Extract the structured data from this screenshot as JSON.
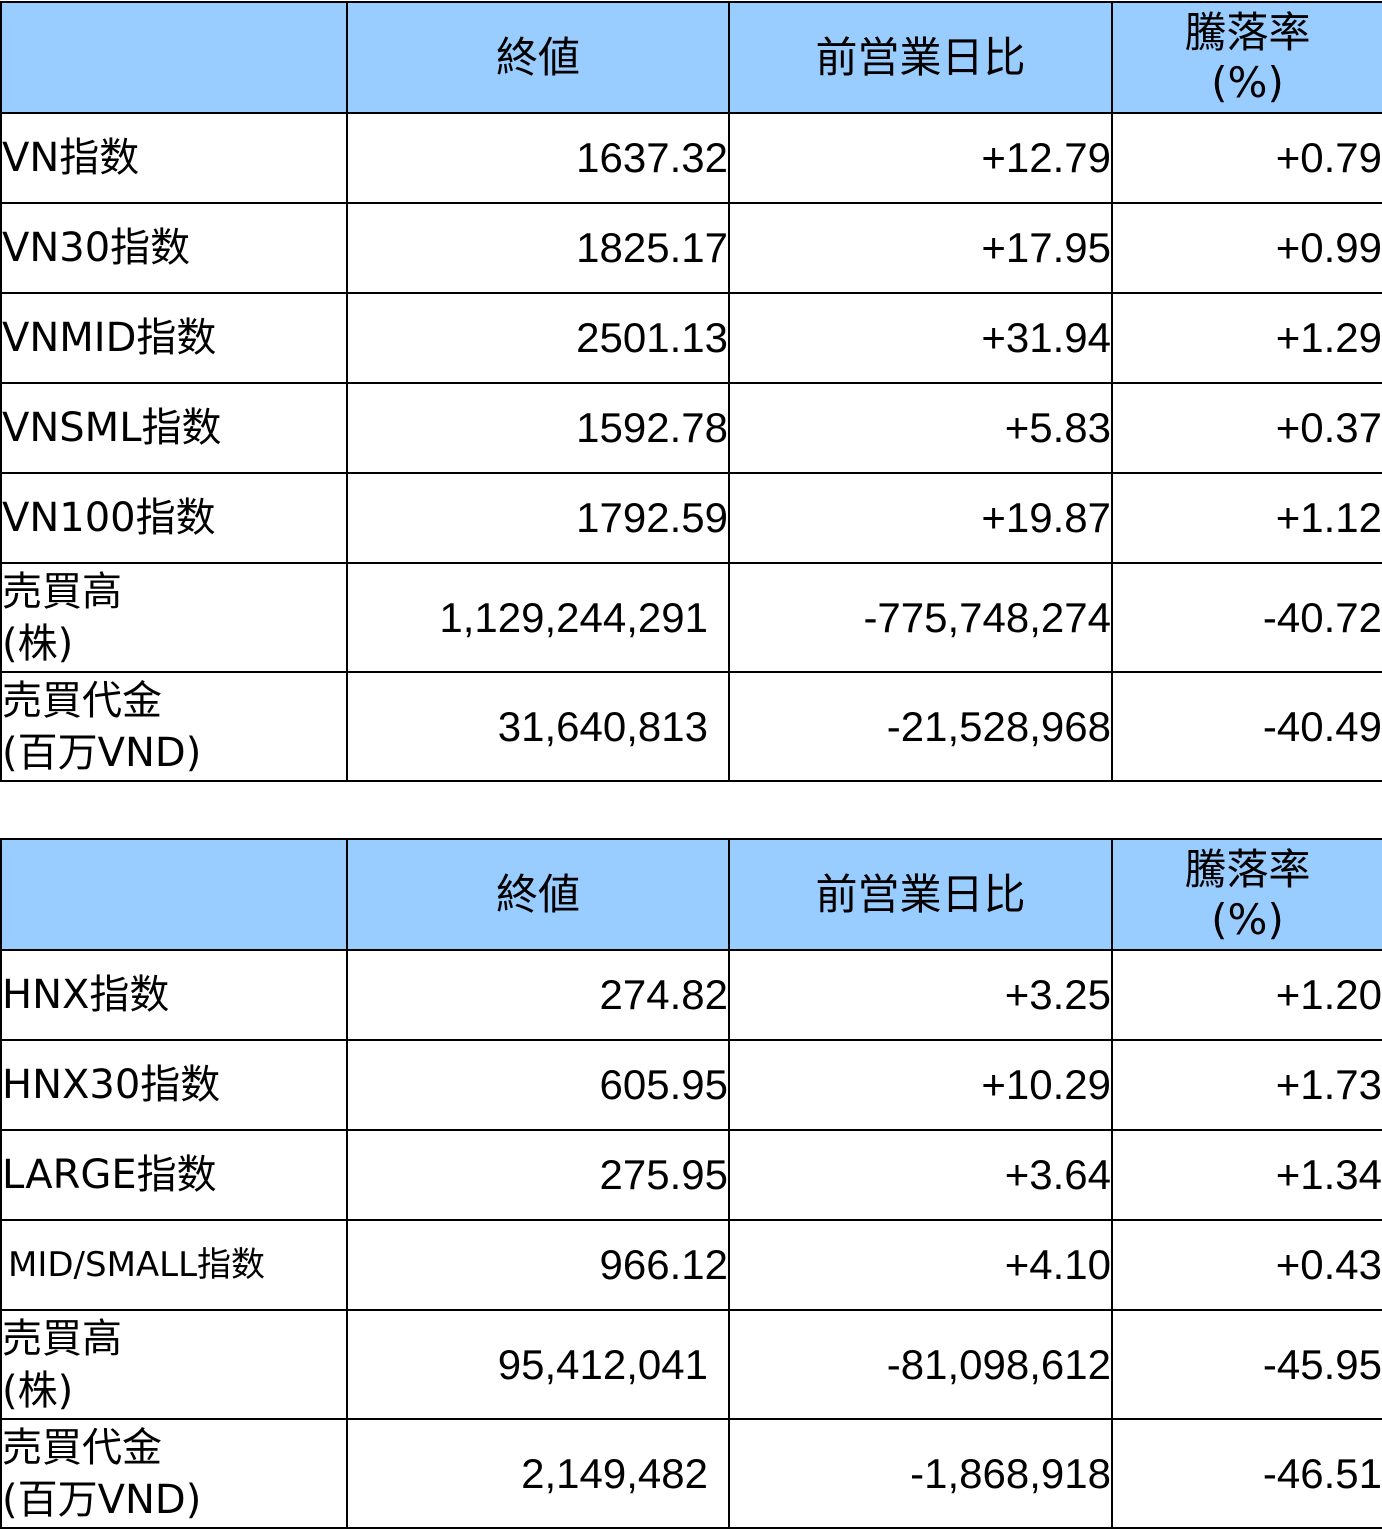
{
  "header": {
    "blank": "",
    "close": "終値",
    "change": "前営業日比",
    "rate_line1": "騰落率",
    "rate_line2": "(%)"
  },
  "vn_table": {
    "rows": [
      {
        "label": "VN指数",
        "close": "1637.32",
        "change": "+12.79",
        "rate": "+0.79"
      },
      {
        "label": "VN30指数",
        "close": "1825.17",
        "change": "+17.95",
        "rate": "+0.99"
      },
      {
        "label": "VNMID指数",
        "close": "2501.13",
        "change": "+31.94",
        "rate": "+1.29"
      },
      {
        "label": "VNSML指数",
        "close": "1592.78",
        "change": "+5.83",
        "rate": "+0.37"
      },
      {
        "label": "VN100指数",
        "close": "1792.59",
        "change": "+19.87",
        "rate": "+1.12"
      },
      {
        "label_line1": "売買高",
        "label_line2": "(株)",
        "close": "1,129,244,291",
        "change": "-775,748,274",
        "rate": "-40.72"
      },
      {
        "label_line1": "売買代金",
        "label_line2": "(百万VND)",
        "close": "31,640,813",
        "change": "-21,528,968",
        "rate": "-40.49"
      }
    ]
  },
  "hnx_table": {
    "rows": [
      {
        "label": "HNX指数",
        "close": "274.82",
        "change": "+3.25",
        "rate": "+1.20"
      },
      {
        "label": "HNX30指数",
        "close": "605.95",
        "change": "+10.29",
        "rate": "+1.73"
      },
      {
        "label": "LARGE指数",
        "close": "275.95",
        "change": "+3.64",
        "rate": "+1.34"
      },
      {
        "label": "MID/SMALL指数",
        "close": "966.12",
        "change": "+4.10",
        "rate": "+0.43"
      },
      {
        "label_line1": "売買高",
        "label_line2": "(株)",
        "close": "95,412,041",
        "change": "-81,098,612",
        "rate": "-45.95"
      },
      {
        "label_line1": "売買代金",
        "label_line2": "(百万VND)",
        "close": "2,149,482",
        "change": "-1,868,918",
        "rate": "-46.51"
      }
    ]
  },
  "colors": {
    "header_bg": "#99ccff",
    "border": "#000000"
  }
}
